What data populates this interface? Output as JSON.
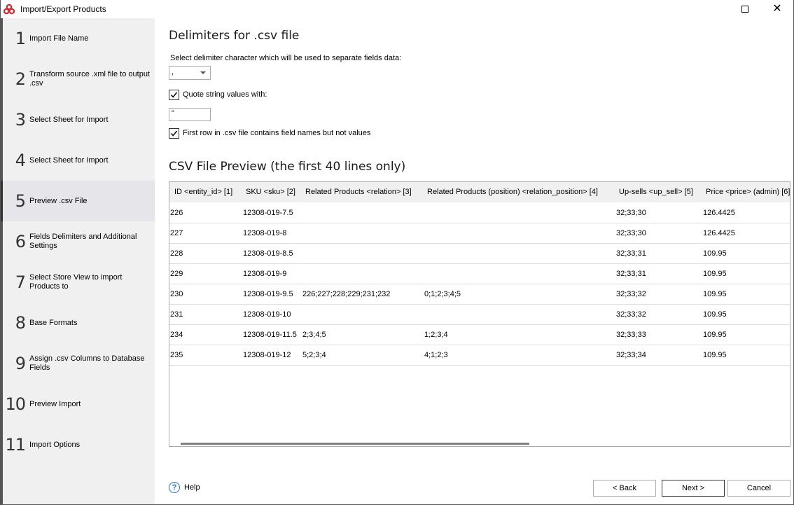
{
  "window": {
    "title": "Import/Export Products",
    "controls": {
      "maximize": "maximize-icon",
      "close": "close-icon"
    }
  },
  "sidebar": {
    "active_step": 5,
    "steps": [
      {
        "num": "1",
        "label": "Import File Name"
      },
      {
        "num": "2",
        "label": "Transform source .xml file to output .csv"
      },
      {
        "num": "3",
        "label": "Select Sheet for Import"
      },
      {
        "num": "4",
        "label": "Select Sheet for Import"
      },
      {
        "num": "5",
        "label": "Preview .csv File"
      },
      {
        "num": "6",
        "label": "Fields Delimiters and Additional Settings"
      },
      {
        "num": "7",
        "label": "Select Store View to import Products to"
      },
      {
        "num": "8",
        "label": "Base Formats"
      },
      {
        "num": "9",
        "label": "Assign .csv Columns to Database Fields"
      },
      {
        "num": "10",
        "label": "Preview Import"
      },
      {
        "num": "11",
        "label": "Import Options"
      }
    ]
  },
  "main": {
    "heading": "Delimiters for .csv file",
    "delimiter_label": "Select delimiter character which will be used to separate fields data:",
    "delimiter_value": ",",
    "quote_checkbox": {
      "label": "Quote string values with:",
      "checked": true
    },
    "quote_value": "\"",
    "first_row_checkbox": {
      "label": "First row in .csv file contains field names but not values",
      "checked": true
    },
    "preview_heading": "CSV File Preview (the first 40 lines only)",
    "grid": {
      "columns": [
        "ID <entity_id> [1]",
        "SKU <sku> [2]",
        "Related Products <relation> [3]",
        "Related Products (position) <relation_position> [4]",
        "Up-sells <up_sell> [5]",
        "Price <price> (admin) [6]"
      ],
      "rows": [
        [
          "226",
          "12308-019-7.5",
          "",
          "",
          "32;33;30",
          "126.4425"
        ],
        [
          "227",
          "12308-019-8",
          "",
          "",
          "32;33;30",
          "126.4425"
        ],
        [
          "228",
          "12308-019-8.5",
          "",
          "",
          "32;33;31",
          "109.95"
        ],
        [
          "229",
          "12308-019-9",
          "",
          "",
          "32;33;31",
          "109.95"
        ],
        [
          "230",
          "12308-019-9.5",
          "226;227;228;229;231;232",
          "0;1;2;3;4;5",
          "32;33;32",
          "109.95"
        ],
        [
          "231",
          "12308-019-10",
          "",
          "",
          "32;33;32",
          "109.95"
        ],
        [
          "234",
          "12308-019-11.5",
          "2;3;4;5",
          "1;2;3;4",
          "32;33;33",
          "109.95"
        ],
        [
          "235",
          "12308-019-12",
          "5;2;3;4",
          "4;1;2;3",
          "32;33;34",
          "109.95"
        ]
      ]
    }
  },
  "footer": {
    "help_label": "Help",
    "back_label": "< Back",
    "next_label": "Next >",
    "cancel_label": "Cancel"
  },
  "colors": {
    "app_icon": "#d9232e",
    "help_icon": "#1e6fd9",
    "sidebar_bg": "#f0f0f0",
    "active_step_bg": "#e6e6ea"
  }
}
